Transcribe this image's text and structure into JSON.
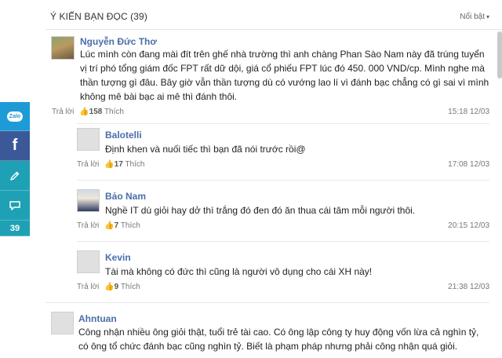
{
  "header": {
    "title": "Ý KIẾN BẠN ĐỌC (39)",
    "sort_label": "Nổi bật",
    "sort_icon": "chevron-down-icon"
  },
  "share": {
    "zalo_label": "Zalo",
    "facebook_label": "f",
    "comment_count": "39"
  },
  "comments": [
    {
      "author": "Nguyễn Đức Thơ",
      "text": "Lúc mình còn đang mài đít trên ghế nhà trường thì anh chàng Phan Sào Nam này đã trúng tuyển vị trí phó tổng giám đốc FPT rất dữ dội, giá cổ phiếu FPT lúc đó 450. 000 VND/cp. Mình nghe mà thần tượng gì đâu. Bây giờ vẫn thần tượng dù có vướng lao lí vì đánh bạc chẳng có gì sai vì mình không mê bài bạc ai mê thì đánh thôi.",
      "reply_label": "Trả lời",
      "likes": "158",
      "like_label": "Thích",
      "time": "15:18 12/03"
    },
    {
      "author": "Balotelli",
      "text": "Định khen và nuối tiếc thì bạn đã nói trước rồi@",
      "reply_label": "Trả lời",
      "likes": "17",
      "like_label": "Thích",
      "time": "17:08 12/03"
    },
    {
      "author": "Bảo Nam",
      "text": "Nghề IT dù giỏi hay dở thì trắng đó đen đó ăn thua cái tâm mỗi người thôi.",
      "reply_label": "Trả lời",
      "likes": "7",
      "like_label": "Thích",
      "time": "20:15 12/03"
    },
    {
      "author": "Kevin",
      "text": "Tài mà không có đức thì cũng là người vô dụng cho cái XH này!",
      "reply_label": "Trả lời",
      "likes": "9",
      "like_label": "Thích",
      "time": "21:38 12/03"
    },
    {
      "author": "Ahntuan",
      "text": "Công nhận nhiều ông giỏi thật, tuổi trẻ tài cao. Có ông lập công ty huy động vốn lừa cả nghìn tỷ, có ông tổ chức đánh bạc cũng nghìn tỷ. Biết là phạm pháp nhưng phải công nhận quá giỏi."
    }
  ]
}
